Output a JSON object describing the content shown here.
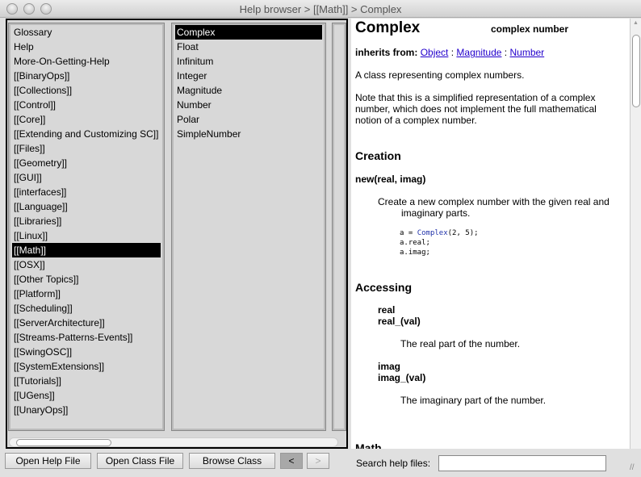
{
  "window": {
    "title": "Help browser > [[Math]] > Complex"
  },
  "categories": [
    "Glossary",
    "Help",
    "More-On-Getting-Help",
    "[[BinaryOps]]",
    "[[Collections]]",
    "[[Control]]",
    "[[Core]]",
    "[[Extending and Customizing SC]]",
    "[[Files]]",
    "[[Geometry]]",
    "[[GUI]]",
    "[[interfaces]]",
    "[[Language]]",
    "[[Libraries]]",
    "[[Linux]]",
    "[[Math]]",
    "[[OSX]]",
    "[[Other Topics]]",
    "[[Platform]]",
    "[[Scheduling]]",
    "[[ServerArchitecture]]",
    "[[Streams-Patterns-Events]]",
    "[[SwingOSC]]",
    "[[SystemExtensions]]",
    "[[Tutorials]]",
    "[[UGens]]",
    "[[UnaryOps]]"
  ],
  "selected_category": "[[Math]]",
  "classes": [
    "Complex",
    "Float",
    "Infinitum",
    "Integer",
    "Magnitude",
    "Number",
    "Polar",
    "SimpleNumber"
  ],
  "selected_class": "Complex",
  "doc": {
    "title": "Complex",
    "subtitle": "complex number",
    "inherits_label": "inherits from:",
    "inherits": [
      "Object",
      "Magnitude",
      "Number"
    ],
    "sep": ":",
    "summary": "A class representing complex numbers.",
    "note": "Note that this is a simplified representation of a complex number, which does not implement the full mathematical notion of a complex number.",
    "creation": "Creation",
    "new_sig": "new(real, imag)",
    "new_desc1": "Create a new complex number with the given real and",
    "new_desc2": "imaginary parts.",
    "code1a": "a = ",
    "code1b": "Complex",
    "code1c": "(2, 5);",
    "code2": "a.real;",
    "code3": "a.imag;",
    "accessing": "Accessing",
    "real": "real",
    "real_set": "real_(val)",
    "real_desc": "The real part of the number.",
    "imag": "imag",
    "imag_set": "imag_(val)",
    "imag_desc": "The imaginary part of the number.",
    "math": "Math"
  },
  "buttons": {
    "open_help": "Open Help File",
    "open_class": "Open Class File",
    "browse_class": "Browse Class",
    "back": "<",
    "forward": ">"
  },
  "search": {
    "label": "Search help files:",
    "value": ""
  }
}
